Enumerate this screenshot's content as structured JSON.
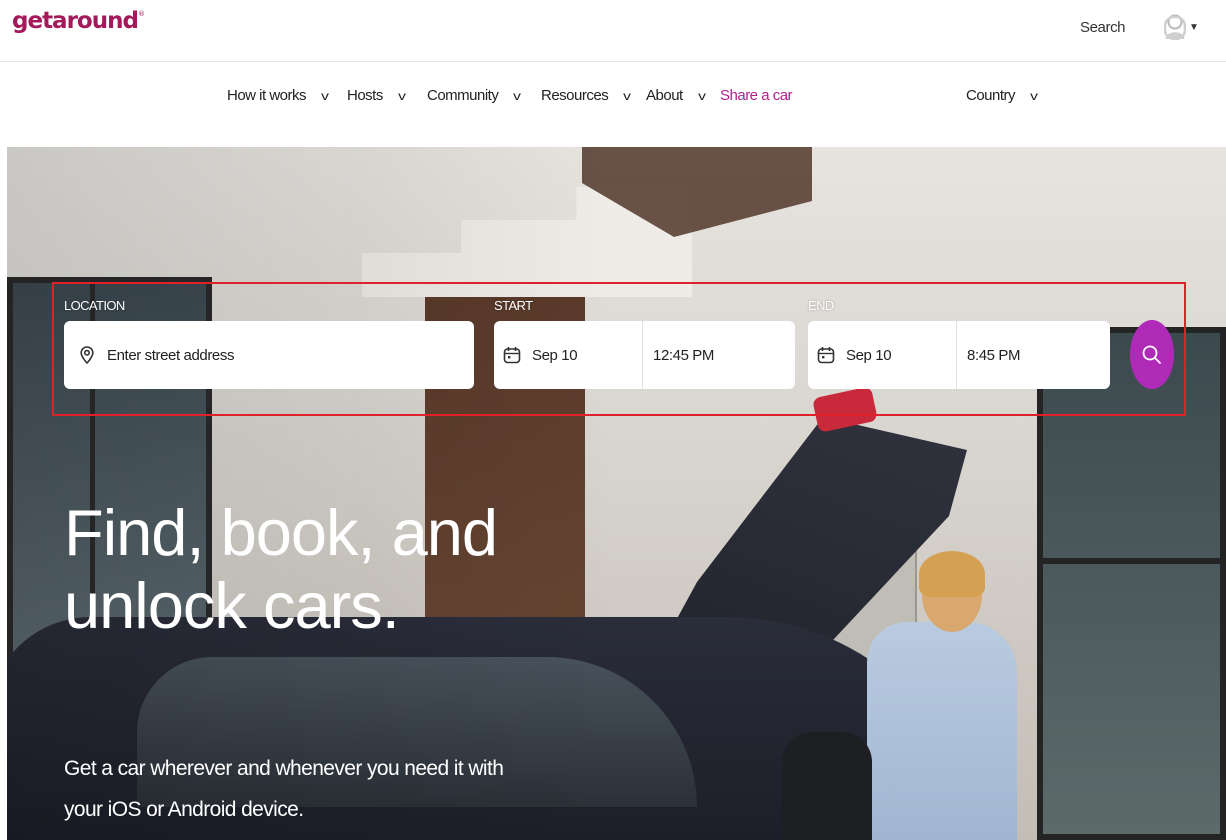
{
  "brand": {
    "logo_text": "getaround",
    "accent_color": "#b11f8f",
    "logo_color": "#a3195b"
  },
  "header": {
    "search_label": "Search"
  },
  "nav": {
    "items": [
      {
        "label": "How it works",
        "chevron": "chevron-down-icon"
      },
      {
        "label": "Hosts",
        "chevron": "chevron-down-icon"
      },
      {
        "label": "Community",
        "chevron": "chevron-down-icon"
      },
      {
        "label": "Resources",
        "chevron": "chevron-down-icon"
      },
      {
        "label": "About",
        "chevron": "chevron-down-icon"
      },
      {
        "label": "Share a car"
      }
    ],
    "country_label": "Country"
  },
  "search_form": {
    "location_label": "LOCATION",
    "location_placeholder": "Enter street address",
    "start_label": "START",
    "start_date": "Sep 10",
    "start_time": "12:45 PM",
    "end_label": "END",
    "end_date": "Sep 10",
    "end_time": "8:45 PM",
    "button_color": "#b02ab8",
    "highlight_color": "#e0212a"
  },
  "hero": {
    "headline": "Find, book, and unlock cars.",
    "subline": "Get a car wherever and whenever you need it with your iOS or Android device."
  }
}
